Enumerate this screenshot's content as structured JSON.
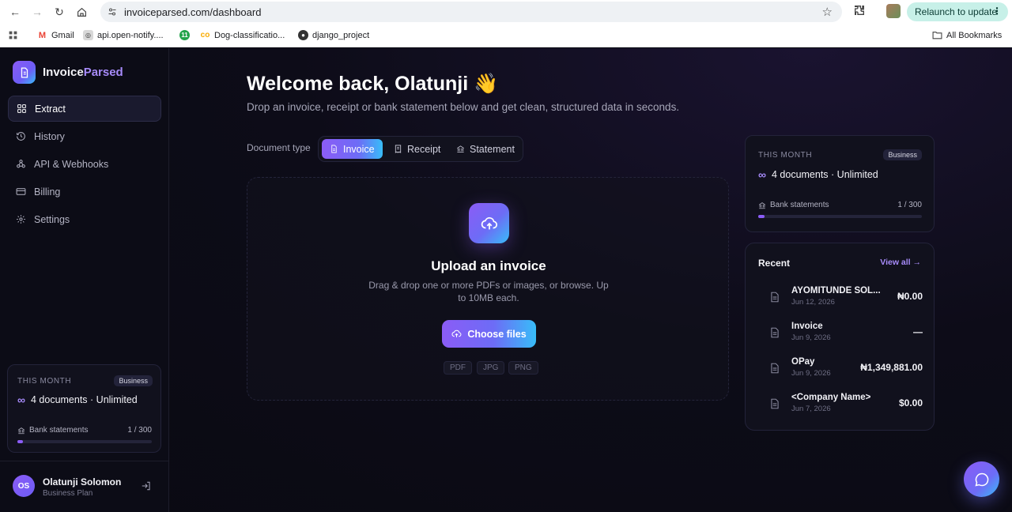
{
  "browser": {
    "url": "invoiceparsed.com/dashboard",
    "relaunch_label": "Relaunch to update",
    "bookmarks": [
      "Gmail",
      "api.open-notify....",
      "Dog-classificatio...",
      "django_project"
    ],
    "all_bookmarks_label": "All Bookmarks"
  },
  "brand": {
    "name_a": "Invoice",
    "name_b": "Parsed",
    "accent_color": "#a78bfa"
  },
  "sidebar": {
    "items": [
      {
        "label": "Extract",
        "icon": "grid-icon",
        "active": true
      },
      {
        "label": "History",
        "icon": "history-icon"
      },
      {
        "label": "API & Webhooks",
        "icon": "webhook-icon"
      },
      {
        "label": "Billing",
        "icon": "card-icon"
      },
      {
        "label": "Settings",
        "icon": "gear-icon"
      }
    ],
    "usage": {
      "label": "THIS MONTH",
      "badge": "Business",
      "plan_line": "4 documents · Unlimited",
      "bank_label": "Bank statements",
      "bank_count": "1 / 300",
      "bank_fraction": 0.0033
    },
    "user": {
      "initials": "OS",
      "name": "Olatunji Solomon",
      "plan": "Business Plan"
    }
  },
  "main": {
    "welcome": "Welcome back, Olatunji 👋",
    "subtitle": "Drop an invoice, receipt or bank statement below and get clean, structured data in seconds.",
    "doctype_label": "Document type",
    "doctypes": [
      {
        "label": "Invoice",
        "active": true
      },
      {
        "label": "Receipt"
      },
      {
        "label": "Statement"
      }
    ],
    "upload": {
      "title": "Upload an invoice",
      "description": "Drag & drop one or more PDFs or images, or browse. Up to 10MB each.",
      "button": "Choose files",
      "formats": [
        "PDF",
        "JPG",
        "PNG"
      ]
    }
  },
  "right_usage": {
    "label": "THIS MONTH",
    "badge": "Business",
    "plan_line": "4 documents · Unlimited",
    "bank_label": "Bank statements",
    "bank_count": "1 / 300",
    "bank_fraction": 0.0033
  },
  "recent": {
    "title": "Recent",
    "view_all": "View all →",
    "items": [
      {
        "name": "AYOMITUNDE SOL...",
        "date": "Jun 12, 2026",
        "amount": "₦0.00"
      },
      {
        "name": "Invoice",
        "date": "Jun 9, 2026",
        "amount": "—"
      },
      {
        "name": "OPay",
        "date": "Jun 9, 2026",
        "amount": "₦1,349,881.00"
      },
      {
        "name": "<Company Name>",
        "date": "Jun 7, 2026",
        "amount": "$0.00"
      }
    ]
  }
}
